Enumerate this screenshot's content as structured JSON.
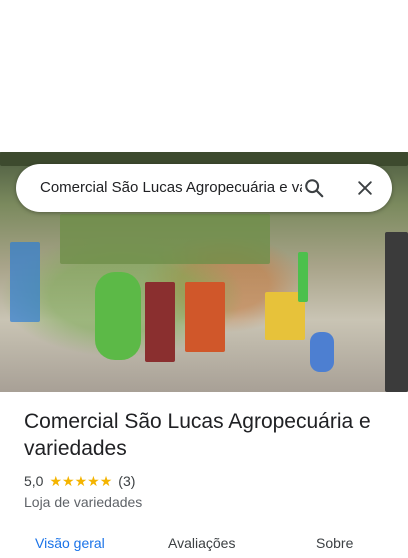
{
  "search": {
    "value": "Comercial São Lucas Agropecuária e variedades"
  },
  "place": {
    "name": "Comercial São Lucas Agropecuária e variedades",
    "rating": "5,0",
    "stars": 5,
    "review_count": "(3)",
    "category": "Loja de variedades"
  },
  "tabs": [
    {
      "label": "Visão geral",
      "active": true
    },
    {
      "label": "Avaliações",
      "active": false
    },
    {
      "label": "Sobre",
      "active": false
    }
  ],
  "colors": {
    "accent": "#1a73e8",
    "star": "#f4b400"
  },
  "icons": {
    "search": "search-icon",
    "close": "close-icon"
  }
}
